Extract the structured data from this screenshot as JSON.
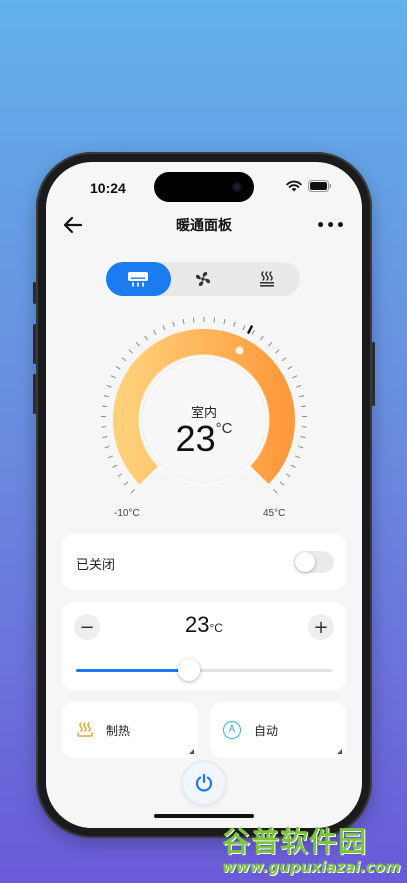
{
  "status_bar": {
    "time": "10:24"
  },
  "nav": {
    "title": "暖通面板",
    "more": "•••"
  },
  "mode_tabs": [
    {
      "name": "air-conditioner",
      "active": true
    },
    {
      "name": "fan",
      "active": false
    },
    {
      "name": "floor-heating",
      "active": false
    }
  ],
  "dial": {
    "label": "室内",
    "temperature": "23",
    "unit": "°C",
    "min_label": "-10°C",
    "max_label": "45°C",
    "min_value": -10,
    "max_value": 45,
    "current_value": 23
  },
  "power_row": {
    "label": "已关闭",
    "toggle_on": false
  },
  "setpoint": {
    "minus": "−",
    "plus": "+",
    "value": "23",
    "unit": "°C",
    "slider_fraction": 0.44
  },
  "mode_card": {
    "label": "制热",
    "icon": "heat-icon"
  },
  "fan_card": {
    "label": "自动",
    "icon": "auto-icon",
    "badge": "A"
  },
  "colors": {
    "accent": "#1a7cf0",
    "dial_start": "#ffd07a",
    "dial_end": "#ff9a3c",
    "heat_icon": "#f0a23a",
    "auto_icon": "#3ab0e8"
  },
  "watermark": {
    "main": "谷普软件园",
    "url": "www.gupuxiazai.com"
  }
}
